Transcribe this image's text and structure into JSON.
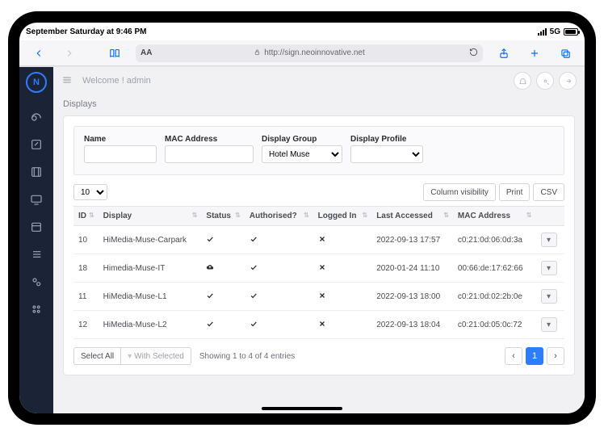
{
  "status": {
    "time": "September Saturday at 9:46 PM",
    "network": "5G"
  },
  "browser": {
    "url": "http://sign.neoinnovative.net"
  },
  "topbar": {
    "welcome": "Welcome ! admin"
  },
  "page": {
    "title": "Displays"
  },
  "filters": {
    "name_label": "Name",
    "mac_label": "MAC Address",
    "group_label": "Display Group",
    "profile_label": "Display Profile",
    "group_selected": "Hotel Muse",
    "profile_selected": ""
  },
  "toolbar": {
    "pagesize": "10",
    "col_vis": "Column visibility",
    "print": "Print",
    "csv": "CSV"
  },
  "columns": [
    "ID",
    "Display",
    "Status",
    "Authorised?",
    "Logged In",
    "Last Accessed",
    "MAC Address"
  ],
  "rows": [
    {
      "id": "10",
      "display": "HiMedia-Muse-Carpark",
      "status": "check",
      "auth": "check",
      "logged": "x",
      "last": "2022-09-13 17:57",
      "mac": "c0:21:0d:06:0d:3a"
    },
    {
      "id": "18",
      "display": "Himedia-Muse-IT",
      "status": "cloud",
      "auth": "check",
      "logged": "x",
      "last": "2020-01-24 11:10",
      "mac": "00:66:de:17:62:66"
    },
    {
      "id": "11",
      "display": "HiMedia-Muse-L1",
      "status": "check",
      "auth": "check",
      "logged": "x",
      "last": "2022-09-13 18:00",
      "mac": "c0:21:0d:02:2b:0e"
    },
    {
      "id": "12",
      "display": "HiMedia-Muse-L2",
      "status": "check",
      "auth": "check",
      "logged": "x",
      "last": "2022-09-13 18:04",
      "mac": "c0:21:0d:05:0c:72"
    }
  ],
  "footer": {
    "select_all": "Select All",
    "with_selected": "With Selected",
    "showing": "Showing 1 to 4 of 4 entries",
    "page": "1"
  }
}
